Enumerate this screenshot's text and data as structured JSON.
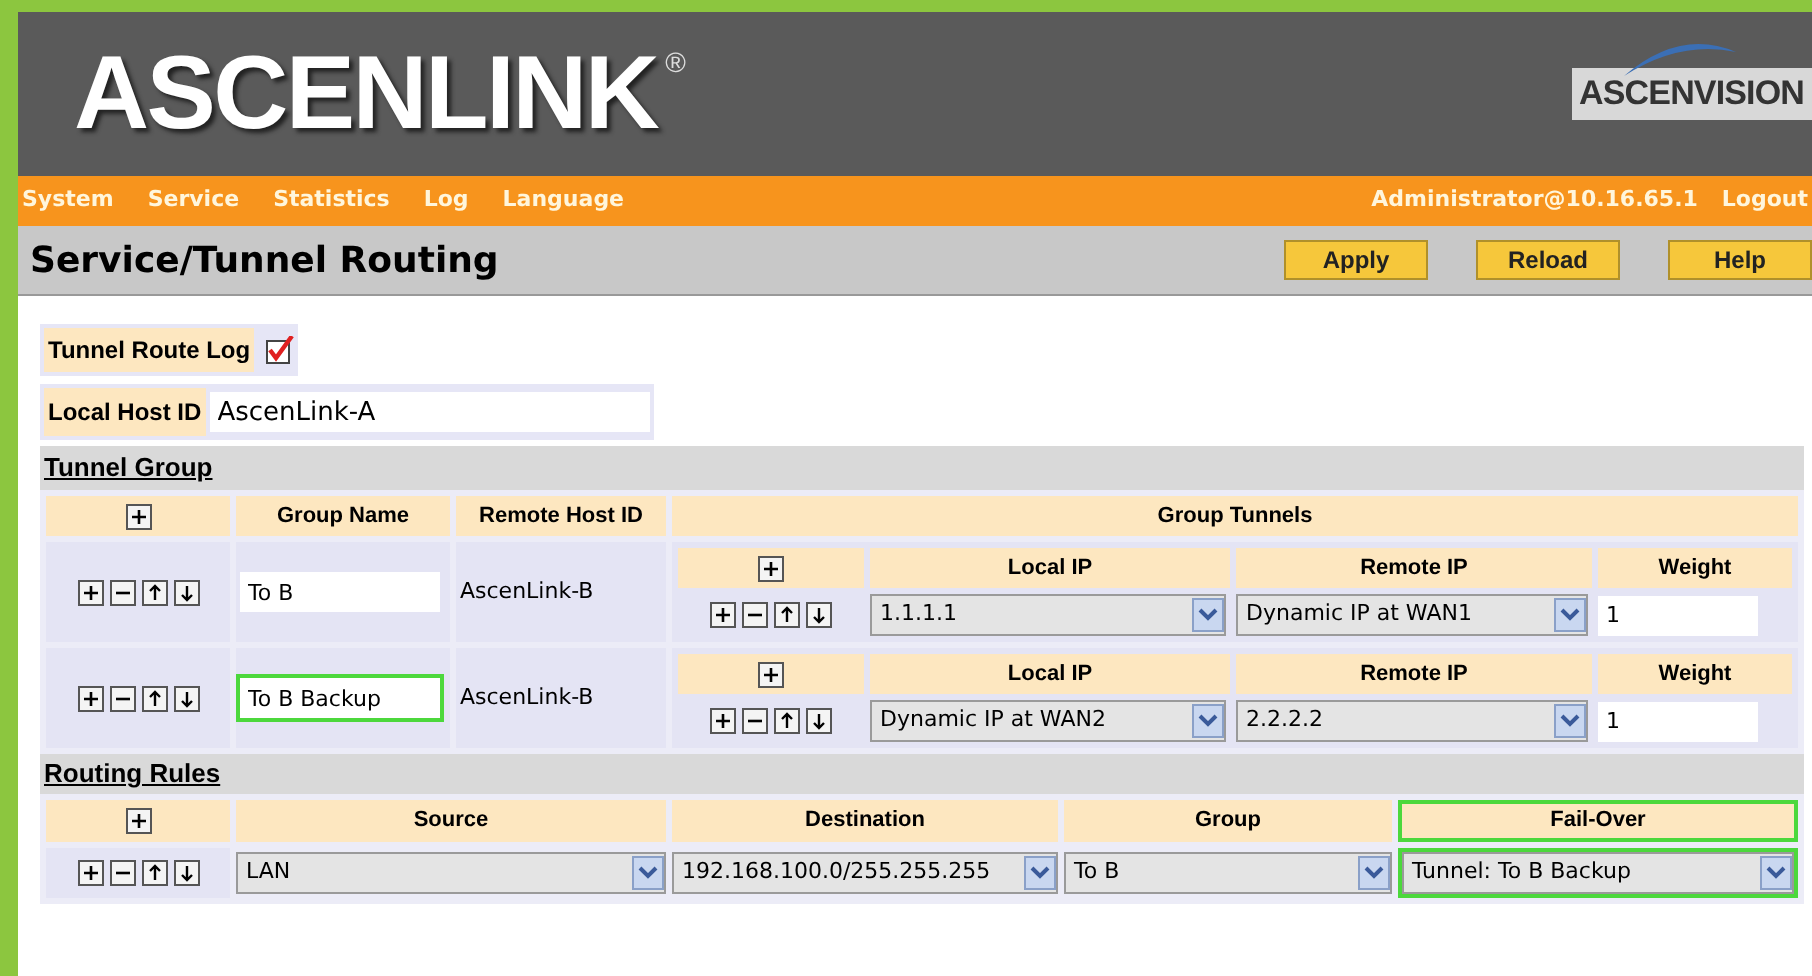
{
  "header": {
    "logo": "ASCENLINK",
    "registered": "®",
    "brand": "ASCENVISION"
  },
  "menu": [
    "System",
    "Service",
    "Statistics",
    "Log",
    "Language"
  ],
  "user": "Administrator@10.16.65.1",
  "logout": "Logout",
  "page_title": "Service/Tunnel Routing",
  "buttons": [
    "Apply",
    "Reload",
    "Help"
  ],
  "tunnel_route_log": {
    "label": "Tunnel Route Log",
    "checked": true
  },
  "local_host_id": {
    "label": "Local Host ID",
    "value": "AscenLink-A"
  },
  "tunnel_group": {
    "title": "Tunnel Group",
    "columns": [
      "Group Name",
      "Remote Host ID",
      "Group Tunnels"
    ],
    "groups": [
      {
        "name": "To B",
        "highlighted": false,
        "remote_host_id": "AscenLink-B",
        "tunnel_columns": [
          "Local IP",
          "Remote IP",
          "Weight"
        ],
        "tunnels": [
          {
            "local_ip": "1.1.1.1",
            "remote_ip": "Dynamic IP at WAN1",
            "weight": "1"
          }
        ]
      },
      {
        "name": "To B Backup",
        "highlighted": true,
        "remote_host_id": "AscenLink-B",
        "tunnel_columns": [
          "Local IP",
          "Remote IP",
          "Weight"
        ],
        "tunnels": [
          {
            "local_ip": "Dynamic IP at WAN2",
            "remote_ip": "2.2.2.2",
            "weight": "1"
          }
        ]
      }
    ]
  },
  "routing_rules": {
    "title": "Routing Rules",
    "columns": [
      {
        "label": "Source",
        "highlighted": false
      },
      {
        "label": "Destination",
        "highlighted": false
      },
      {
        "label": "Group",
        "highlighted": false
      },
      {
        "label": "Fail-Over",
        "highlighted": true
      }
    ],
    "rows": [
      {
        "cells": [
          "LAN",
          "192.168.100.0/255.255.255",
          "To B",
          "Tunnel: To B Backup"
        ]
      }
    ]
  }
}
